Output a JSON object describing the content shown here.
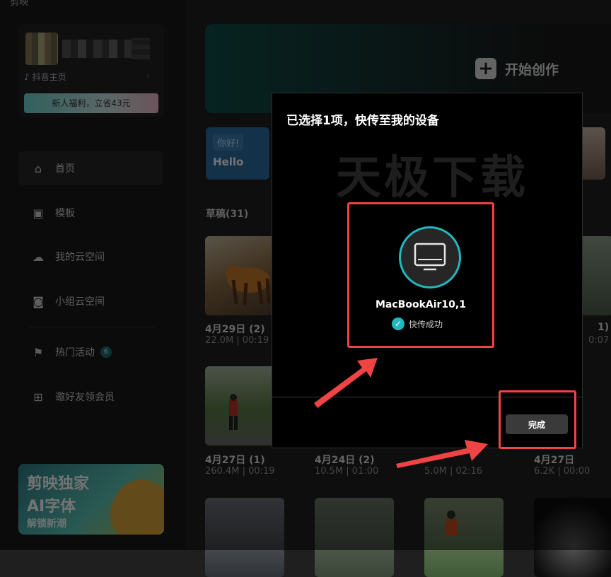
{
  "app": {
    "title": "剪映"
  },
  "profile": {
    "douyin_link": "抖音主页",
    "promo": "新人福利，立省43元"
  },
  "nav": {
    "home": "首页",
    "templates": "模板",
    "cloud": "我的云空间",
    "team_cloud": "小组云空间",
    "events": "热门活动",
    "events_badge": "6",
    "invite": "邀好友领会员"
  },
  "banner": {
    "line1": "剪映独家",
    "line2": "AI字体",
    "line3": "解锁新潮"
  },
  "create": {
    "label": "开始创作"
  },
  "tutorial": {
    "tag": "你好!",
    "text": "Hello"
  },
  "drafts": {
    "title": "草稿(31)",
    "items": [
      {
        "date": "4月29日 (2)",
        "info": "22.0M | 00:19"
      },
      {
        "date": "1)",
        "info": "0:07"
      },
      {
        "date": "4月27日 (1)",
        "info": "260.4M | 00:19"
      },
      {
        "date": "4月24日 (2)",
        "info": "10.5M | 01:00"
      },
      {
        "date": "",
        "info": "5.0M | 02:16"
      },
      {
        "date": "4月27日",
        "info": "6.2K | 00:00"
      }
    ]
  },
  "modal": {
    "title": "已选择1项，快传至我的设备",
    "watermark": "天极下载",
    "device_name": "MacBookAir10,1",
    "status": "快传成功",
    "done_label": "完成"
  },
  "colors": {
    "accent": "#22b8c0",
    "highlight": "#f04444"
  }
}
